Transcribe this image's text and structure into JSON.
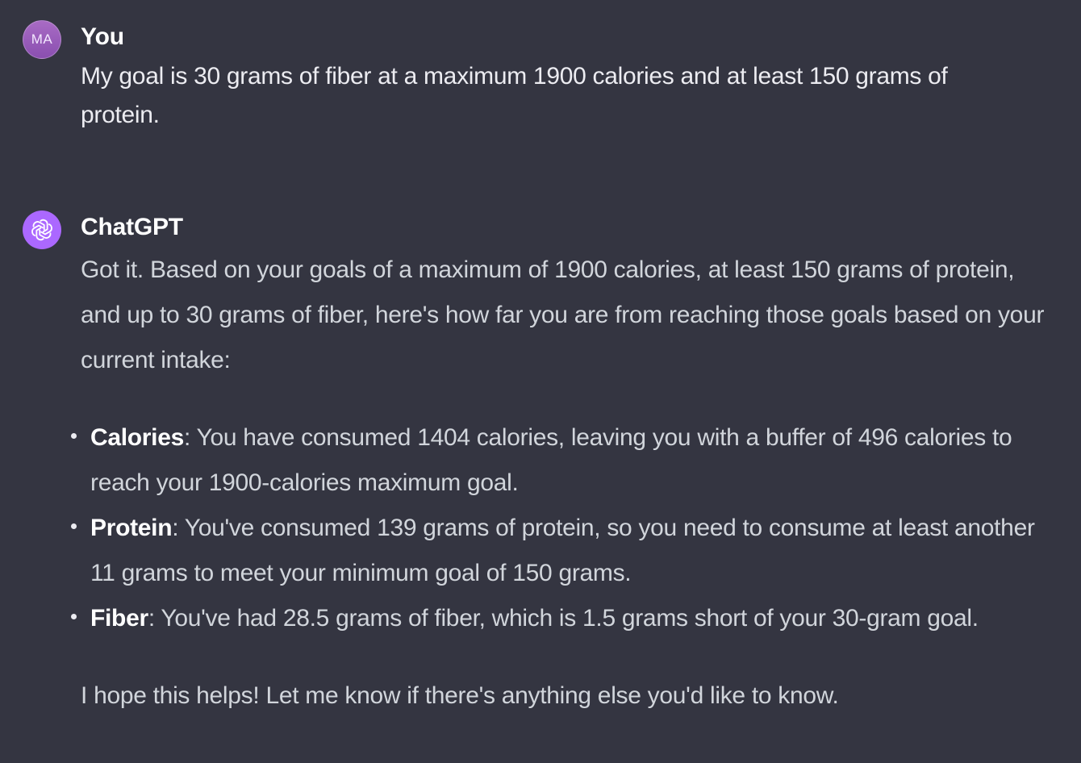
{
  "conversation": {
    "user_message": {
      "avatar_initials": "MA",
      "author": "You",
      "text": "My goal is 30 grams of fiber at a maximum 1900 calories and at least 150 grams of protein."
    },
    "assistant_message": {
      "avatar_icon": "openai-logo-icon",
      "author": "ChatGPT",
      "intro": "Got it. Based on your goals of a maximum of 1900 calories, at least 150 grams of protein, and up to 30 grams of fiber, here's how far you are from reaching those goals based on your current intake:",
      "bullets": [
        {
          "term": "Calories",
          "text": ": You have consumed 1404 calories, leaving you with a buffer of 496 calories to reach your 1900-calories maximum goal."
        },
        {
          "term": "Protein",
          "text": ": You've consumed 139 grams of protein, so you need to consume at least another 11 grams to meet your minimum goal of 150 grams."
        },
        {
          "term": "Fiber",
          "text": ": You've had 28.5 grams of fiber, which is 1.5 grams short of your 30-gram goal."
        }
      ],
      "closing": "I hope this helps! Let me know if there's anything else you'd like to know."
    }
  },
  "colors": {
    "background": "#343541",
    "user_avatar": "#9b59b6",
    "assistant_avatar": "#ab68ff"
  }
}
